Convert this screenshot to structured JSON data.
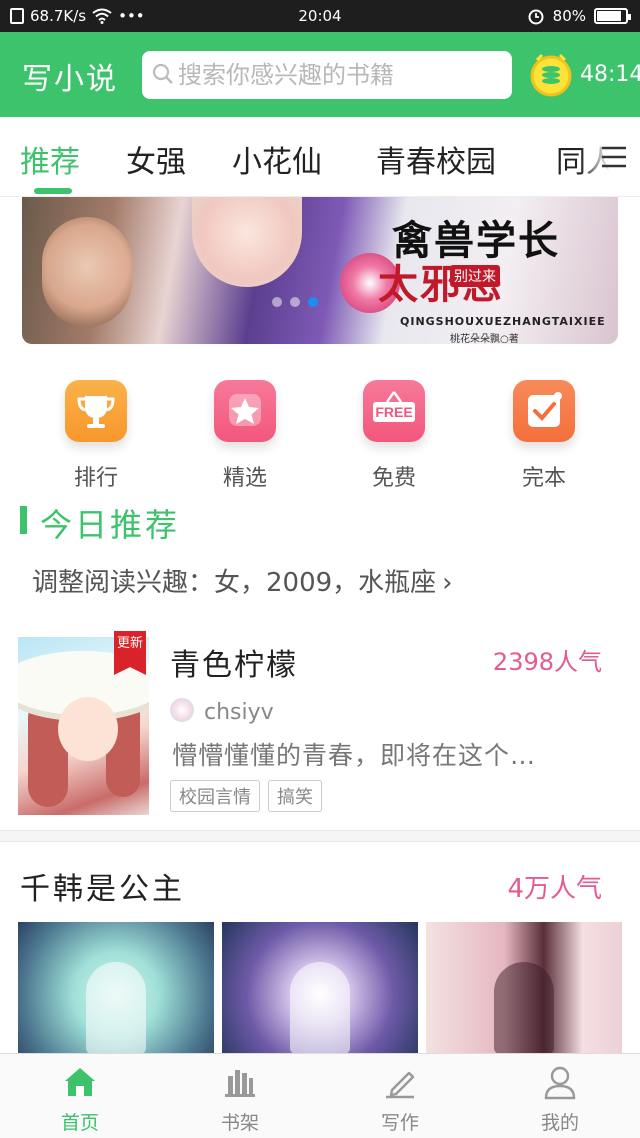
{
  "status_bar": {
    "speed": "68.7K/s",
    "dots": "•••",
    "time": "20:04",
    "battery": "80%",
    "battery_level": 0.8
  },
  "header": {
    "logo": "写小说",
    "search_placeholder": "搜索你感兴趣的书籍",
    "timer": "48:14"
  },
  "tabs": [
    "推荐",
    "女强",
    "小花仙",
    "青春校园",
    "同人"
  ],
  "active_tab": 0,
  "banner": {
    "title_line1": "禽兽学长",
    "title_line2": "太邪恶",
    "subtitle": "别过来",
    "pinyin": "QINGSHOUXUEZHANGTAIXIEE",
    "author": "桃花朵朵飘○著"
  },
  "quick_entries": [
    {
      "label": "排行",
      "icon": "trophy-icon",
      "color": "#f7982b"
    },
    {
      "label": "精选",
      "icon": "star-icon",
      "color": "#f2577c"
    },
    {
      "label": "免费",
      "icon": "free-icon",
      "color": "#f2577c",
      "badge": "FREE"
    },
    {
      "label": "完本",
      "icon": "check-icon",
      "color": "#f46f3b"
    }
  ],
  "section_today": {
    "title": "今日推荐",
    "interest": "调整阅读兴趣：女，2009，水瓶座"
  },
  "featured_book": {
    "ribbon": "更新",
    "title": "青色柠檬",
    "popularity": "2398人气",
    "author": "chsiyv",
    "description": "懵懵懂懂的青春，即将在这个…",
    "tags": [
      "校园言情",
      "搞笑"
    ]
  },
  "section_two": {
    "title": "千韩是公主",
    "popularity": "4万人气"
  },
  "bottom_nav": [
    {
      "label": "首页",
      "icon": "home-icon"
    },
    {
      "label": "书架",
      "icon": "bookshelf-icon"
    },
    {
      "label": "写作",
      "icon": "pen-icon"
    },
    {
      "label": "我的",
      "icon": "user-icon"
    }
  ],
  "active_nav": 0,
  "colors": {
    "brand_green": "#3cc36b",
    "popularity_pink": "#e45a93",
    "ribbon_red": "#d8232a"
  }
}
